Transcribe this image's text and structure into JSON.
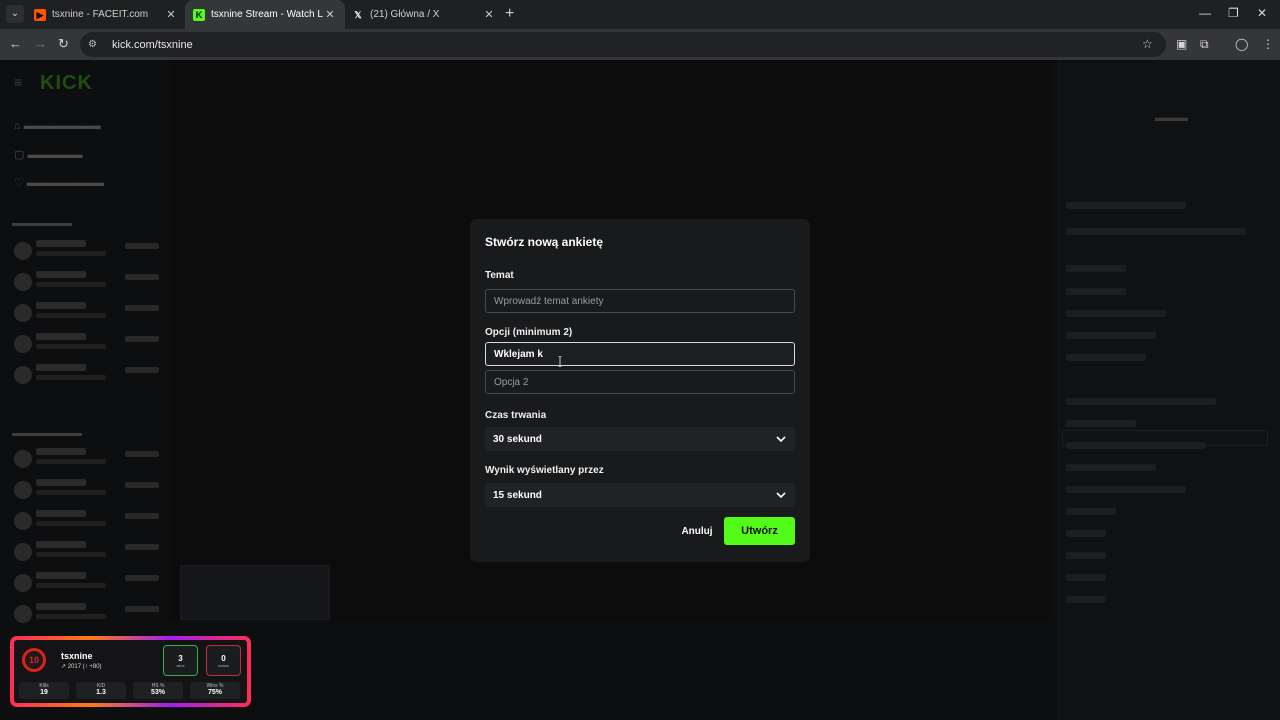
{
  "browser": {
    "tabs": [
      {
        "title": "tsxnine - FACEIT.com",
        "active": false
      },
      {
        "title": "tsxnine Stream - Watch Live on Kick",
        "active": true
      },
      {
        "title": "(21) Główna / X",
        "active": false
      }
    ],
    "url": "kick.com/tsxnine"
  },
  "modal": {
    "title": "Stwórz nową ankietę",
    "topic_label": "Temat",
    "topic_placeholder": "Wprowadź temat ankiety",
    "options_label": "Opcji (minimum 2)",
    "option1_value": "Wklejam k",
    "option2_placeholder": "Opcja 2",
    "duration_label": "Czas trwania",
    "duration_value": "30 sekund",
    "result_label": "Wynik wyświetlany przez",
    "result_value": "15 sekund",
    "cancel_label": "Anuluj",
    "create_label": "Utwórz"
  },
  "faceit_widget": {
    "level": "10",
    "name": "tsxnine",
    "elo": "↗ 2017 (↑ +80)",
    "wins": "3",
    "losses": "0",
    "stats": [
      {
        "label": "Kills",
        "value": "19"
      },
      {
        "label": "K/D",
        "value": "1.3"
      },
      {
        "label": "HS %",
        "value": "53%"
      },
      {
        "label": "Wins %",
        "value": "75%"
      }
    ]
  },
  "colors": {
    "kick_green": "#53fc18",
    "faceit_red": "#e0201a",
    "modal_bg": "#191a1c"
  }
}
